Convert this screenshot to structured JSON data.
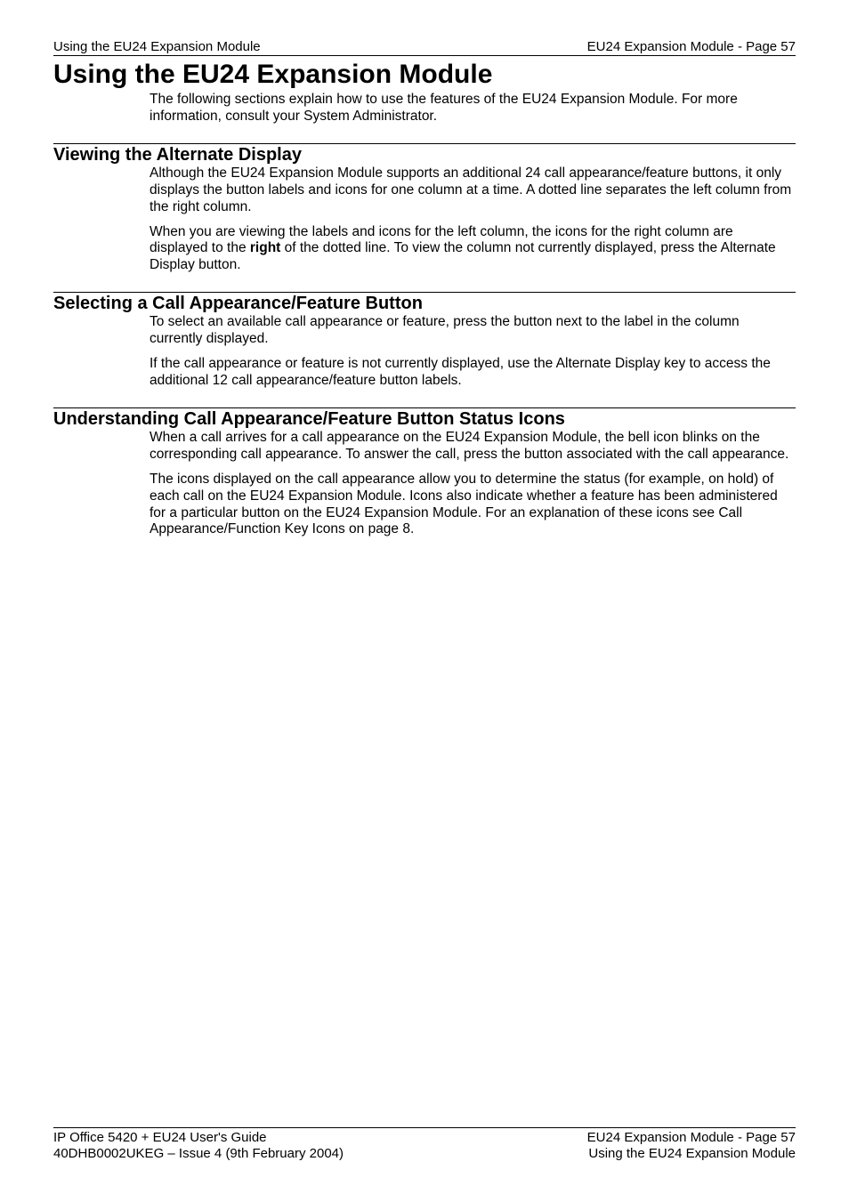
{
  "header": {
    "left": "Using the EU24 Expansion Module",
    "right": "EU24 Expansion Module - Page 57"
  },
  "title": "Using the EU24 Expansion Module",
  "intro": "The following sections explain how to use the features of the EU24 Expansion Module. For more information, consult your System Administrator.",
  "sections": [
    {
      "heading": "Viewing the Alternate Display",
      "paras": [
        {
          "pre": "Although the EU24 Expansion Module supports an additional 24 call appearance/feature buttons, it only displays the button labels and icons for one column at a time. A dotted line separates the left column from the right column."
        },
        {
          "pre": "When you are viewing the labels and icons for the left column, the icons for the right column are displayed to the ",
          "bold": "right",
          "post": " of the dotted line. To view the column not currently displayed, press the Alternate Display button."
        }
      ]
    },
    {
      "heading": "Selecting a Call Appearance/Feature Button",
      "paras": [
        {
          "pre": "To select an available call appearance or feature, press the button next to the label in the column currently displayed."
        },
        {
          "pre": "If the call appearance or feature is not currently displayed, use the Alternate Display key to access the additional 12 call appearance/feature button labels."
        }
      ]
    },
    {
      "heading": "Understanding Call Appearance/Feature Button Status Icons",
      "paras": [
        {
          "pre": "When a call arrives for a call appearance on the EU24 Expansion Module, the bell icon blinks on the corresponding call appearance. To answer the call, press the button associated with the call appearance."
        },
        {
          "pre": "The icons displayed on the call appearance allow you to determine the status (for example, on hold) of each call on the EU24 Expansion Module. Icons also indicate whether a feature has been administered for a particular button on the EU24 Expansion Module. For an explanation of these icons see Call Appearance/Function Key Icons on page 8."
        }
      ]
    }
  ],
  "footer": {
    "left1": "IP Office 5420 + EU24 User's Guide",
    "left2": "40DHB0002UKEG – Issue 4 (9th February 2004)",
    "right1": "EU24 Expansion Module - Page 57",
    "right2": "Using the EU24 Expansion Module"
  }
}
